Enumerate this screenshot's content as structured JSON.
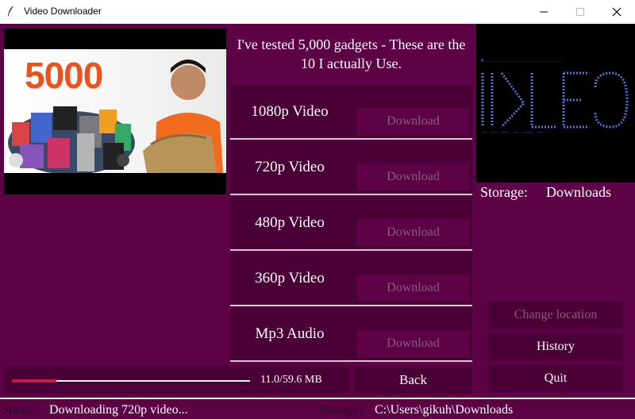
{
  "window": {
    "title": "Video Downloader",
    "title_bar_icons": [
      "app-feather-icon",
      "minimize-icon",
      "maximize-icon",
      "close-icon"
    ]
  },
  "thumbnail": {
    "overlay_text": "5000",
    "overlay_color": "#e8531e"
  },
  "video": {
    "title": "I've tested 5,000 gadgets - These are the 10 I actually Use."
  },
  "formats": [
    {
      "label": "1080p Video",
      "button": "Download"
    },
    {
      "label": "720p Video",
      "button": "Download"
    },
    {
      "label": "480p Video",
      "button": "Download"
    },
    {
      "label": "360p Video",
      "button": "Download"
    },
    {
      "label": "Mp3 Audio",
      "button": "Download"
    }
  ],
  "progress": {
    "fraction": 0.185,
    "text": "11.0/59.6 MB"
  },
  "buttons": {
    "back": "Back",
    "change_location": "Change location",
    "history": "History",
    "quit": "Quit"
  },
  "storage": {
    "label": "Storage:",
    "value": "Downloads"
  },
  "status_bar": {
    "status_label": "Status :",
    "status_text": "Downloading 720p video...",
    "storage_label": "Storage :",
    "storage_path": "C:\\Users\\gikuh\\Downloads"
  },
  "colors": {
    "background": "#5c0245",
    "panel": "#4a0136",
    "accent_progress": "#c8184a",
    "disabled_text": "#8d5a7f",
    "logo_text": "#4a7ad8"
  }
}
